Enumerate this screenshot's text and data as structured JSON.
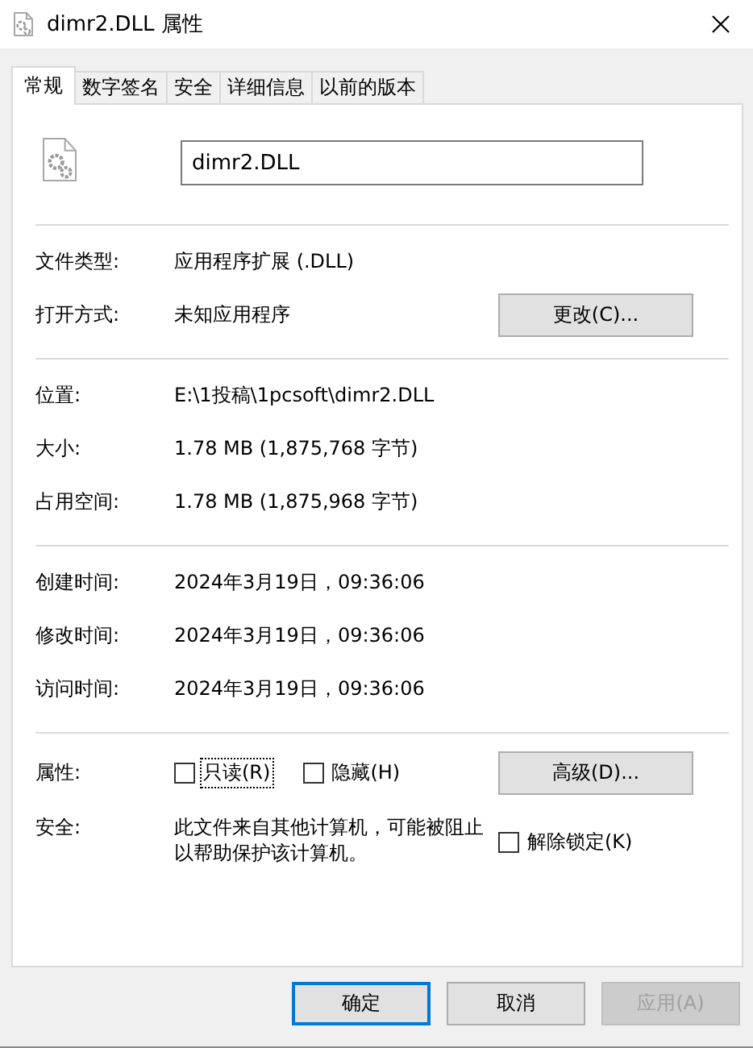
{
  "window": {
    "title": "dimr2.DLL 属性"
  },
  "tabs": [
    {
      "label": "常规",
      "selected": true
    },
    {
      "label": "数字签名",
      "selected": false
    },
    {
      "label": "安全",
      "selected": false
    },
    {
      "label": "详细信息",
      "selected": false
    },
    {
      "label": "以前的版本",
      "selected": false
    }
  ],
  "file": {
    "name": "dimr2.DLL"
  },
  "groups": [
    [
      {
        "label": "文件类型:",
        "value": "应用程序扩展 (.DLL)"
      },
      {
        "label": "打开方式:",
        "value": "未知应用程序",
        "button": "更改(C)..."
      }
    ],
    [
      {
        "label": "位置:",
        "value": "E:\\1投稿\\1pcsoft\\dimr2.DLL"
      },
      {
        "label": "大小:",
        "value": "1.78 MB (1,875,768 字节)"
      },
      {
        "label": "占用空间:",
        "value": "1.78 MB (1,875,968 字节)"
      }
    ],
    [
      {
        "label": "创建时间:",
        "value": "2024年3月19日，09:36:06"
      },
      {
        "label": "修改时间:",
        "value": "2024年3月19日，09:36:06"
      },
      {
        "label": "访问时间:",
        "value": "2024年3月19日，09:36:06"
      }
    ]
  ],
  "attributes": {
    "label": "属性:",
    "checkboxes": [
      {
        "label": "只读(R)",
        "checked": false,
        "focused": true
      },
      {
        "label": "隐藏(H)",
        "checked": false,
        "focused": false
      }
    ],
    "button": "高级(D)..."
  },
  "security": {
    "label": "安全:",
    "text": "此文件来自其他计算机，可能被阻止以帮助保护该计算机。",
    "checkbox": {
      "label": "解除锁定(K)",
      "checked": false
    }
  },
  "buttons": [
    {
      "label": "确定",
      "default": true,
      "disabled": false
    },
    {
      "label": "取消",
      "default": false,
      "disabled": false
    },
    {
      "label": "应用(A)",
      "default": false,
      "disabled": true
    }
  ]
}
